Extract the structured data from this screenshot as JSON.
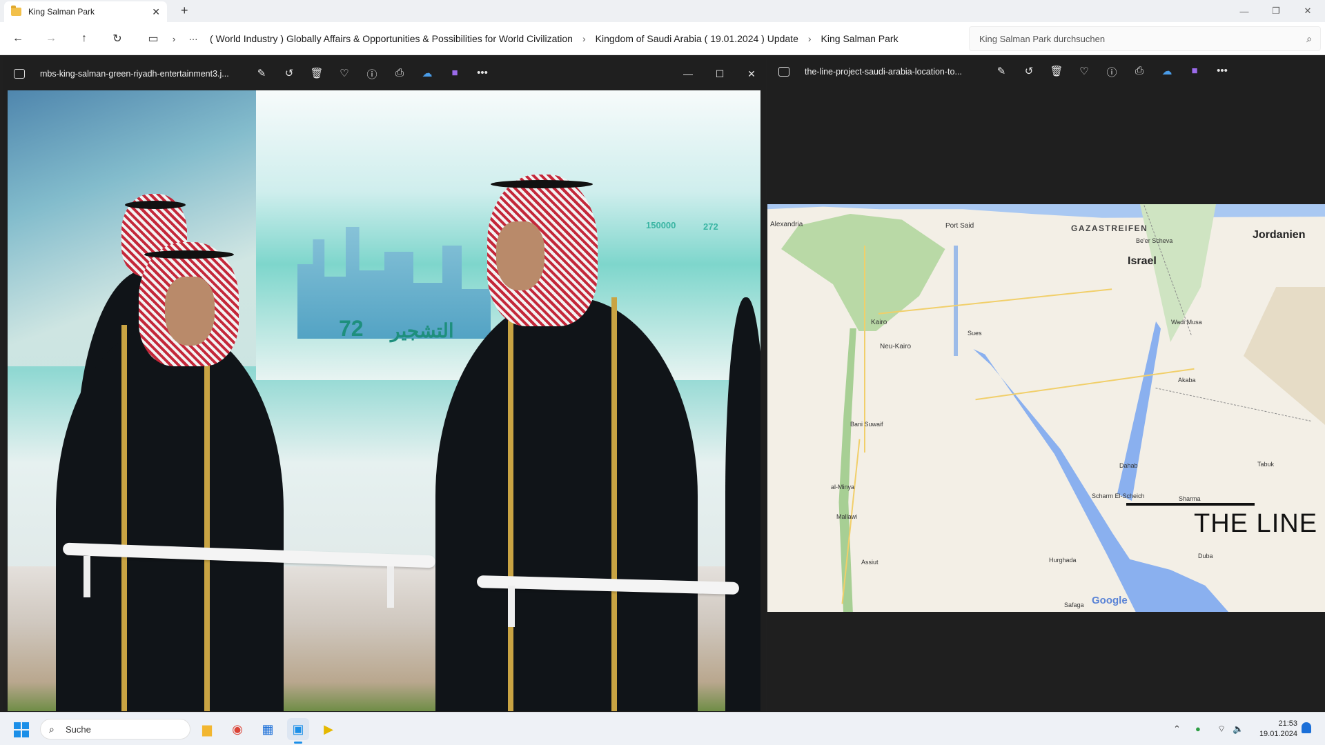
{
  "explorer": {
    "tab_title": "King Salman Park",
    "new_tab": "+",
    "breadcrumbs": [
      "( World Industry ) Globally Affairs & Opportunities & Possibilities for World Civilization",
      "Kingdom of Saudi Arabia ( 19.01.2024 ) Update",
      "King Salman Park"
    ],
    "search_placeholder": "King Salman Park durchsuchen",
    "ellipsis": "···"
  },
  "viewer_left": {
    "filename": "mbs-king-salman-green-riyadh-entertainment3.j...",
    "photo_text": {
      "stat1": "150000",
      "stat2": "272",
      "big_number": "72",
      "arabic_heading": "التشجير"
    }
  },
  "viewer_right": {
    "filename": "the-line-project-saudi-arabia-location-to...",
    "map": {
      "countries": [
        "Israel",
        "Jordanien"
      ],
      "regions": [
        "GAZASTREIFEN"
      ],
      "cities": [
        "Alexandria",
        "Port Said",
        "Be'er Scheva",
        "Kairo",
        "Neu-Kairo",
        "Sues",
        "Wadi Musa",
        "Akaba",
        "Bani Suwaif",
        "Dahab",
        "Tabuk",
        "al-Minya",
        "Scharm El-Scheich",
        "Sharma",
        "Mallawi",
        "Hurghada",
        "Duba",
        "Assiut",
        "Safaga"
      ],
      "overlay_title": "THE LINE",
      "attribution": "Google"
    }
  },
  "taskbar": {
    "search_label": "Suche",
    "time": "21:53",
    "date": "19.01.2024"
  },
  "colors": {
    "accent": "#1b8fe8",
    "viewer_bg": "#1f1f1f",
    "sea": "#8ab0ef"
  }
}
